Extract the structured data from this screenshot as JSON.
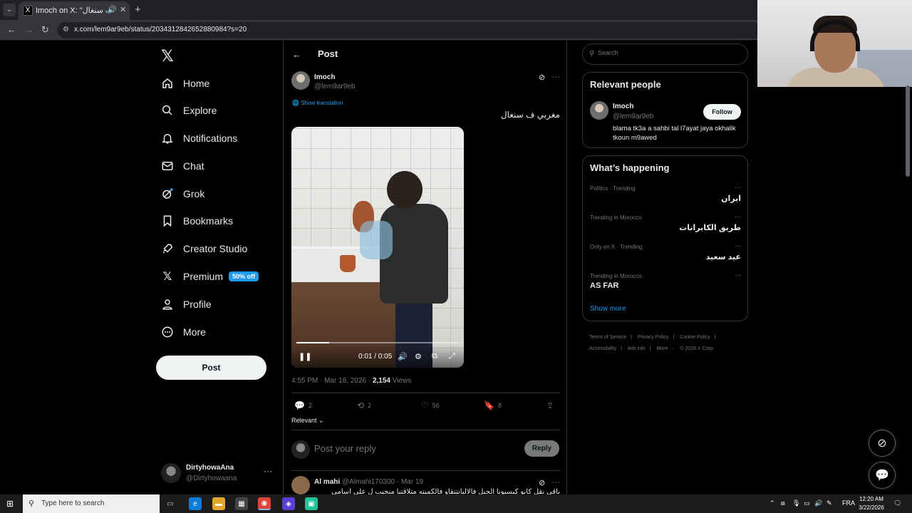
{
  "browser": {
    "tab_title": "Imoch on X: \"مغربي ف سنغال",
    "url": "x.com/lem9ar9eb/status/2034312842652880984?s=20",
    "tab_close": "✕",
    "new_tab": "+"
  },
  "nav": {
    "logo": "𝕏",
    "items": [
      {
        "label": "Home",
        "icon": "home-icon"
      },
      {
        "label": "Explore",
        "icon": "search-icon"
      },
      {
        "label": "Notifications",
        "icon": "bell-icon"
      },
      {
        "label": "Chat",
        "icon": "mail-icon"
      },
      {
        "label": "Grok",
        "icon": "grok-icon"
      },
      {
        "label": "Bookmarks",
        "icon": "bookmark-icon"
      },
      {
        "label": "Creator Studio",
        "icon": "rocket-icon"
      },
      {
        "label": "Premium",
        "icon": "x-icon"
      },
      {
        "label": "Profile",
        "icon": "person-icon"
      },
      {
        "label": "More",
        "icon": "more-circle-icon"
      }
    ],
    "premium_badge": "50% off",
    "post_button": "Post",
    "account": {
      "name": "DirtyhowaAna",
      "handle": "@Dirtyhowaana",
      "more": "···"
    }
  },
  "post": {
    "header_title": "Post",
    "author_name": "Imoch",
    "author_handle": "@lem9ar9eb",
    "show_translation": "Show translation",
    "text": "مغربي ف سنغال",
    "video": {
      "time": "0:01 / 0:05",
      "progress": 0.2
    },
    "timestamp": "4:55 PM · Mar 18, 2026 · ",
    "views_count": "2,154",
    "views_label": " Views",
    "stats": {
      "replies": "2",
      "reposts": "2",
      "likes": "56",
      "bookmarks": "8"
    },
    "sort": "Relevant",
    "reply_placeholder": "Post your reply",
    "reply_button": "Reply"
  },
  "comment": {
    "name": "Al mahi",
    "handle": "@Almahi170300 · Mar 19",
    "text": "باقي نقل كانو كيسيونا الجيل فالالبانتنقاو فالكميته متلاقتيا منجيب ل على أسامي"
  },
  "sidebar_right": {
    "search_placeholder": "Search",
    "relevant_people": {
      "title": "Relevant people",
      "name": "Imoch",
      "handle": "@lem9ar9eb",
      "bio": "blama tk3a a sahbi tal l7ayat jaya okhalik tkoun m9awed",
      "follow": "Follow"
    },
    "whats_happening": {
      "title": "What’s happening",
      "trends": [
        {
          "context": "Politics · Trending",
          "name": "ايران"
        },
        {
          "context": "Trending in Morocco",
          "name": "طريق الكابرانات"
        },
        {
          "context": "Only on X · Trending",
          "name": "عيد سعيد"
        },
        {
          "context": "Trending in Morocco",
          "name": "AS FAR"
        }
      ],
      "show_more": "Show more"
    },
    "footer_links": [
      "Terms of Service",
      "|",
      "Privacy Policy",
      "|",
      "Cookie Policy",
      "|",
      "Accessibility",
      "|",
      "Ads info",
      "|",
      "More ···",
      "© 2026 X Corp."
    ]
  },
  "taskbar": {
    "search_placeholder": "Type here to search",
    "lang": "FRA",
    "time": "12:20 AM",
    "date": "3/22/2026"
  },
  "colors": {
    "accent": "#1d9bf0",
    "background": "#000000",
    "border": "#2f3336",
    "muted": "#71767b"
  }
}
